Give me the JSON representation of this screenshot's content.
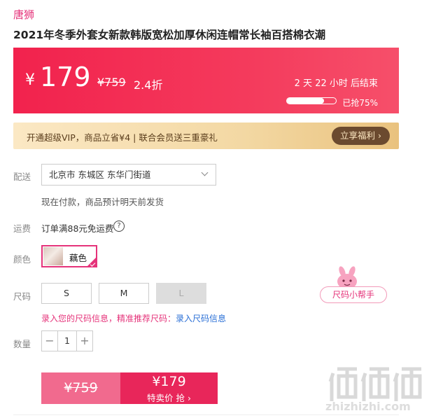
{
  "brand": "唐狮",
  "product_title": "2021年冬季外套女新款韩版宽松加厚休闲连帽常长袖百搭棉衣潮",
  "price": {
    "currency": "¥",
    "value": "179",
    "original": "¥759",
    "discount": "2.4折",
    "countdown": "2  天  22  小时  后结束",
    "sold_label": "已抢75%",
    "sold_fraction": 0.75
  },
  "vip": {
    "text": "开通超级VIP，商品立省¥4 | 联合会员送三重豪礼",
    "button": "立享福利 ›"
  },
  "delivery": {
    "label": "配送",
    "address": "北京市 东城区 东华门街道",
    "note": "现在付款，商品预计明天前发货"
  },
  "freight": {
    "label": "运费",
    "text": "订单满88元免运费",
    "help_icon": "?"
  },
  "color": {
    "label": "颜色",
    "selected": "藕色"
  },
  "size": {
    "label": "尺码",
    "options": [
      "S",
      "M",
      "L"
    ],
    "hint": "录入您的尺码信息，精准推荐尺码：",
    "hint_link": "录入尺码信息",
    "helper": "尺码小帮手"
  },
  "quantity": {
    "label": "数量",
    "value": "1",
    "minus": "−",
    "plus": "+"
  },
  "buy": {
    "original": "¥759",
    "price": "¥179",
    "sub": "特卖价 抢 ›"
  },
  "watermark": "zhizhizhi.com",
  "colors": {
    "accent": "#e5337a",
    "banner": "#f2224d"
  }
}
